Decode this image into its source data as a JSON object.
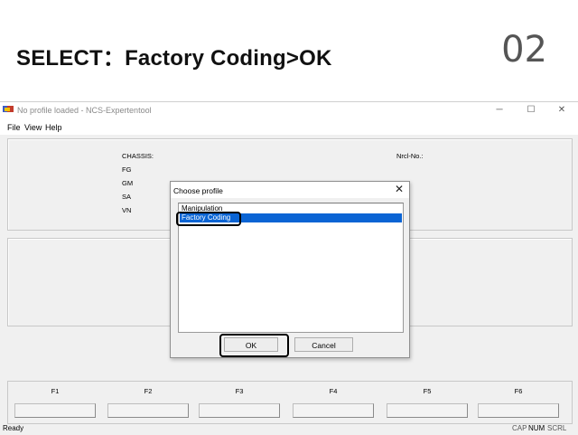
{
  "slide": {
    "heading": "SELECT：Factory Coding>OK",
    "step_number": "02"
  },
  "window": {
    "title": "No profile loaded - NCS-Expertentool",
    "controls": [
      "─",
      "☐",
      "✕"
    ],
    "menu": [
      "File",
      "View",
      "Help"
    ]
  },
  "info_panel": {
    "chassis_label": "CHASSIS:",
    "fg_label": "FG",
    "gm_label": "GM",
    "sa_label": "SA",
    "vn_label": "VN",
    "nrcl_label": "Nrcl-No.:"
  },
  "function_keys": [
    "F1",
    "F2",
    "F3",
    "F4",
    "F5",
    "F6"
  ],
  "status_bar": {
    "left": "Ready",
    "cap": "CAP",
    "num": "NUM",
    "scrl": "SCRL"
  },
  "dialog": {
    "title": "Choose profile",
    "close": "✕",
    "items": [
      "Manipulation",
      "Factory Coding"
    ],
    "selected_index": 1,
    "ok_label": "OK",
    "cancel_label": "Cancel"
  },
  "colors": {
    "selection": "#0a64d4",
    "highlight_outline": "#000000"
  }
}
